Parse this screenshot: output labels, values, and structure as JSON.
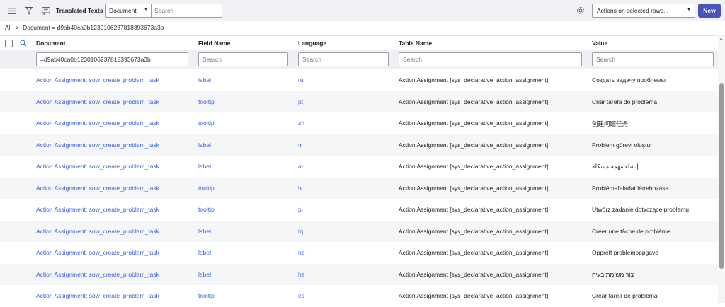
{
  "toolbar": {
    "title": "Translated Texts",
    "filter_field": "Document",
    "search_placeholder": "Search",
    "actions_label": "Actions on selected rows...",
    "new_label": "New",
    "icons": [
      "hamburger-menu-icon",
      "filter-icon",
      "chat-bubble-icon",
      "gear-icon"
    ]
  },
  "breadcrumb": {
    "all": "All",
    "separator": ">",
    "condition": "Document = d9ab40ca0b1230106237818393673a3b"
  },
  "columns": [
    {
      "label": "Document",
      "filter_value": "=d9ab40ca0b1230106237818393673a3b",
      "placeholder": "Search"
    },
    {
      "label": "Field Name",
      "filter_value": "",
      "placeholder": "Search"
    },
    {
      "label": "Language",
      "filter_value": "",
      "placeholder": "Search"
    },
    {
      "label": "Table Name",
      "filter_value": "",
      "placeholder": "Search"
    },
    {
      "label": "Value",
      "filter_value": "",
      "placeholder": "Search"
    }
  ],
  "rows": [
    {
      "document": "Action Assignment: sow_create_problem_task",
      "field": "label",
      "language": "ru",
      "table": "Action Assignment [sys_declarative_action_assignment]",
      "value": "Создать задачу проблемы"
    },
    {
      "document": "Action Assignment: sow_create_problem_task",
      "field": "tooltip",
      "language": "pt",
      "table": "Action Assignment [sys_declarative_action_assignment]",
      "value": "Criar tarefa do problema"
    },
    {
      "document": "Action Assignment: sow_create_problem_task",
      "field": "tooltip",
      "language": "zh",
      "table": "Action Assignment [sys_declarative_action_assignment]",
      "value": "创建问题任务"
    },
    {
      "document": "Action Assignment: sow_create_problem_task",
      "field": "label",
      "language": "tr",
      "table": "Action Assignment [sys_declarative_action_assignment]",
      "value": "Problem görevi oluştur"
    },
    {
      "document": "Action Assignment: sow_create_problem_task",
      "field": "label",
      "language": "ar",
      "table": "Action Assignment [sys_declarative_action_assignment]",
      "value": "إنشاء مهمة مشكلة"
    },
    {
      "document": "Action Assignment: sow_create_problem_task",
      "field": "tooltip",
      "language": "hu",
      "table": "Action Assignment [sys_declarative_action_assignment]",
      "value": "Problémafeladat létrehozása"
    },
    {
      "document": "Action Assignment: sow_create_problem_task",
      "field": "tooltip",
      "language": "pl",
      "table": "Action Assignment [sys_declarative_action_assignment]",
      "value": "Utwórz zadanie dotyczące problemu"
    },
    {
      "document": "Action Assignment: sow_create_problem_task",
      "field": "label",
      "language": "fq",
      "table": "Action Assignment [sys_declarative_action_assignment]",
      "value": "Créer une tâche de problème"
    },
    {
      "document": "Action Assignment: sow_create_problem_task",
      "field": "label",
      "language": "nb",
      "table": "Action Assignment [sys_declarative_action_assignment]",
      "value": "Opprett problemoppgave"
    },
    {
      "document": "Action Assignment: sow_create_problem_task",
      "field": "label",
      "language": "he",
      "table": "Action Assignment [sys_declarative_action_assignment]",
      "value": "צור משימת בעיה"
    },
    {
      "document": "Action Assignment: sow_create_problem_task",
      "field": "tooltip",
      "language": "es",
      "table": "Action Assignment [sys_declarative_action_assignment]",
      "value": "Crear tarea de problema"
    }
  ],
  "colors": {
    "accent": "#4a53b8",
    "link": "#3b5fd0",
    "toolbar_bg": "#f1f2f5"
  }
}
